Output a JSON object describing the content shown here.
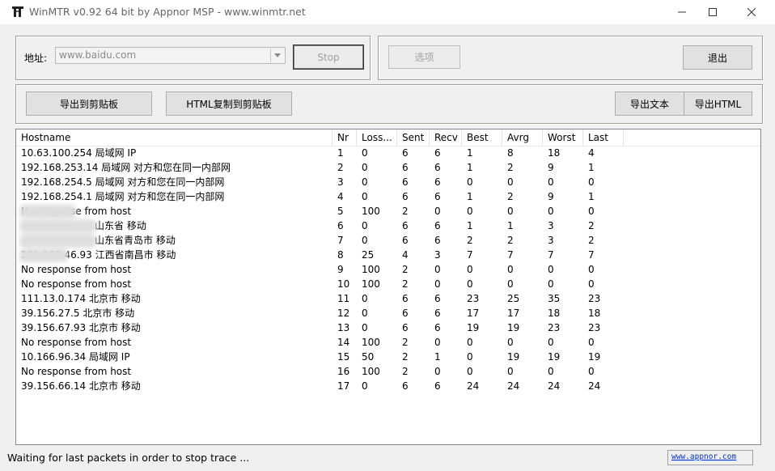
{
  "window": {
    "title": "WinMTR v0.92 64 bit by Appnor MSP - www.winmtr.net"
  },
  "address": {
    "label": "地址:",
    "value": "www.baidu.com"
  },
  "buttons": {
    "stop": "Stop",
    "options": "选项",
    "exit": "退出",
    "copy_text": "导出到剪贴板",
    "copy_html": "HTML复制到剪贴板",
    "export_text": "导出文本",
    "export_html": "导出HTML"
  },
  "table": {
    "columns": [
      "Hostname",
      "Nr",
      "Loss...",
      "Sent",
      "Recv",
      "Best",
      "Avrg",
      "Worst",
      "Last"
    ],
    "rows": [
      [
        "10.63.100.254 局域网 IP",
        "1",
        "0",
        "6",
        "6",
        "1",
        "8",
        "18",
        "4"
      ],
      [
        "192.168.253.14 局域网 对方和您在同一内部网",
        "2",
        "0",
        "6",
        "6",
        "1",
        "2",
        "9",
        "1"
      ],
      [
        "192.168.254.5 局域网 对方和您在同一内部网",
        "3",
        "0",
        "6",
        "6",
        "0",
        "0",
        "0",
        "0"
      ],
      [
        "192.168.254.1 局域网 对方和您在同一内部网",
        "4",
        "0",
        "6",
        "6",
        "1",
        "2",
        "9",
        "1"
      ],
      [
        "No response from host",
        "5",
        "100",
        "2",
        "0",
        "0",
        "0",
        "0",
        "0"
      ],
      [
        "山东省 移动",
        "6",
        "0",
        "6",
        "6",
        "1",
        "1",
        "3",
        "2"
      ],
      [
        "山东省青岛市 移动",
        "7",
        "0",
        "6",
        "6",
        "2",
        "2",
        "3",
        "2"
      ],
      [
        "221.183.46.93 江西省南昌市 移动",
        "8",
        "25",
        "4",
        "3",
        "7",
        "7",
        "7",
        "7"
      ],
      [
        "No response from host",
        "9",
        "100",
        "2",
        "0",
        "0",
        "0",
        "0",
        "0"
      ],
      [
        "No response from host",
        "10",
        "100",
        "2",
        "0",
        "0",
        "0",
        "0",
        "0"
      ],
      [
        "111.13.0.174 北京市 移动",
        "11",
        "0",
        "6",
        "6",
        "23",
        "25",
        "35",
        "23"
      ],
      [
        "39.156.27.5 北京市 移动",
        "12",
        "0",
        "6",
        "6",
        "17",
        "17",
        "18",
        "18"
      ],
      [
        "39.156.67.93 北京市 移动",
        "13",
        "0",
        "6",
        "6",
        "19",
        "19",
        "23",
        "23"
      ],
      [
        "No response from host",
        "14",
        "100",
        "2",
        "0",
        "0",
        "0",
        "0",
        "0"
      ],
      [
        "10.166.96.34 局域网 IP",
        "15",
        "50",
        "2",
        "1",
        "0",
        "19",
        "19",
        "19"
      ],
      [
        "No response from host",
        "16",
        "100",
        "2",
        "0",
        "0",
        "0",
        "0",
        "0"
      ],
      [
        "39.156.66.14 北京市 移动",
        "17",
        "0",
        "6",
        "6",
        "24",
        "24",
        "24",
        "24"
      ]
    ]
  },
  "status": {
    "text": "Waiting for last packets in order to stop trace ...",
    "link": "www.appnor.com"
  }
}
